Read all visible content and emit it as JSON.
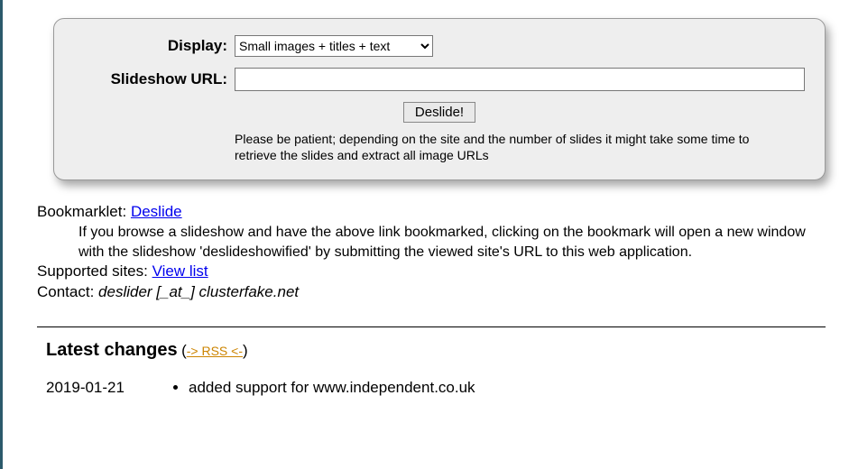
{
  "form": {
    "display_label": "Display:",
    "display_selected": "Small images + titles + text",
    "url_label": "Slideshow URL:",
    "url_value": "",
    "submit_label": "Deslide!",
    "patience_text": "Please be patient; depending on the site and the number of slides it might take some time to retrieve the slides and extract all image URLs"
  },
  "bookmarklet": {
    "label": "Bookmarklet:",
    "link_text": "Deslide",
    "description": "If you browse a slideshow and have the above link bookmarked, clicking on the bookmark will open a new window with the slideshow 'deslideshowified' by submitting the viewed site's URL to this web application."
  },
  "supported": {
    "label": "Supported sites:",
    "link_text": "View list"
  },
  "contact": {
    "label": "Contact:",
    "email": "deslider [_at_] clusterfake.net"
  },
  "changes": {
    "heading": "Latest changes",
    "rss_text": "-> RSS <-",
    "items": [
      {
        "date": "2019-01-21",
        "entry": "added support for www.independent.co.uk"
      }
    ]
  }
}
